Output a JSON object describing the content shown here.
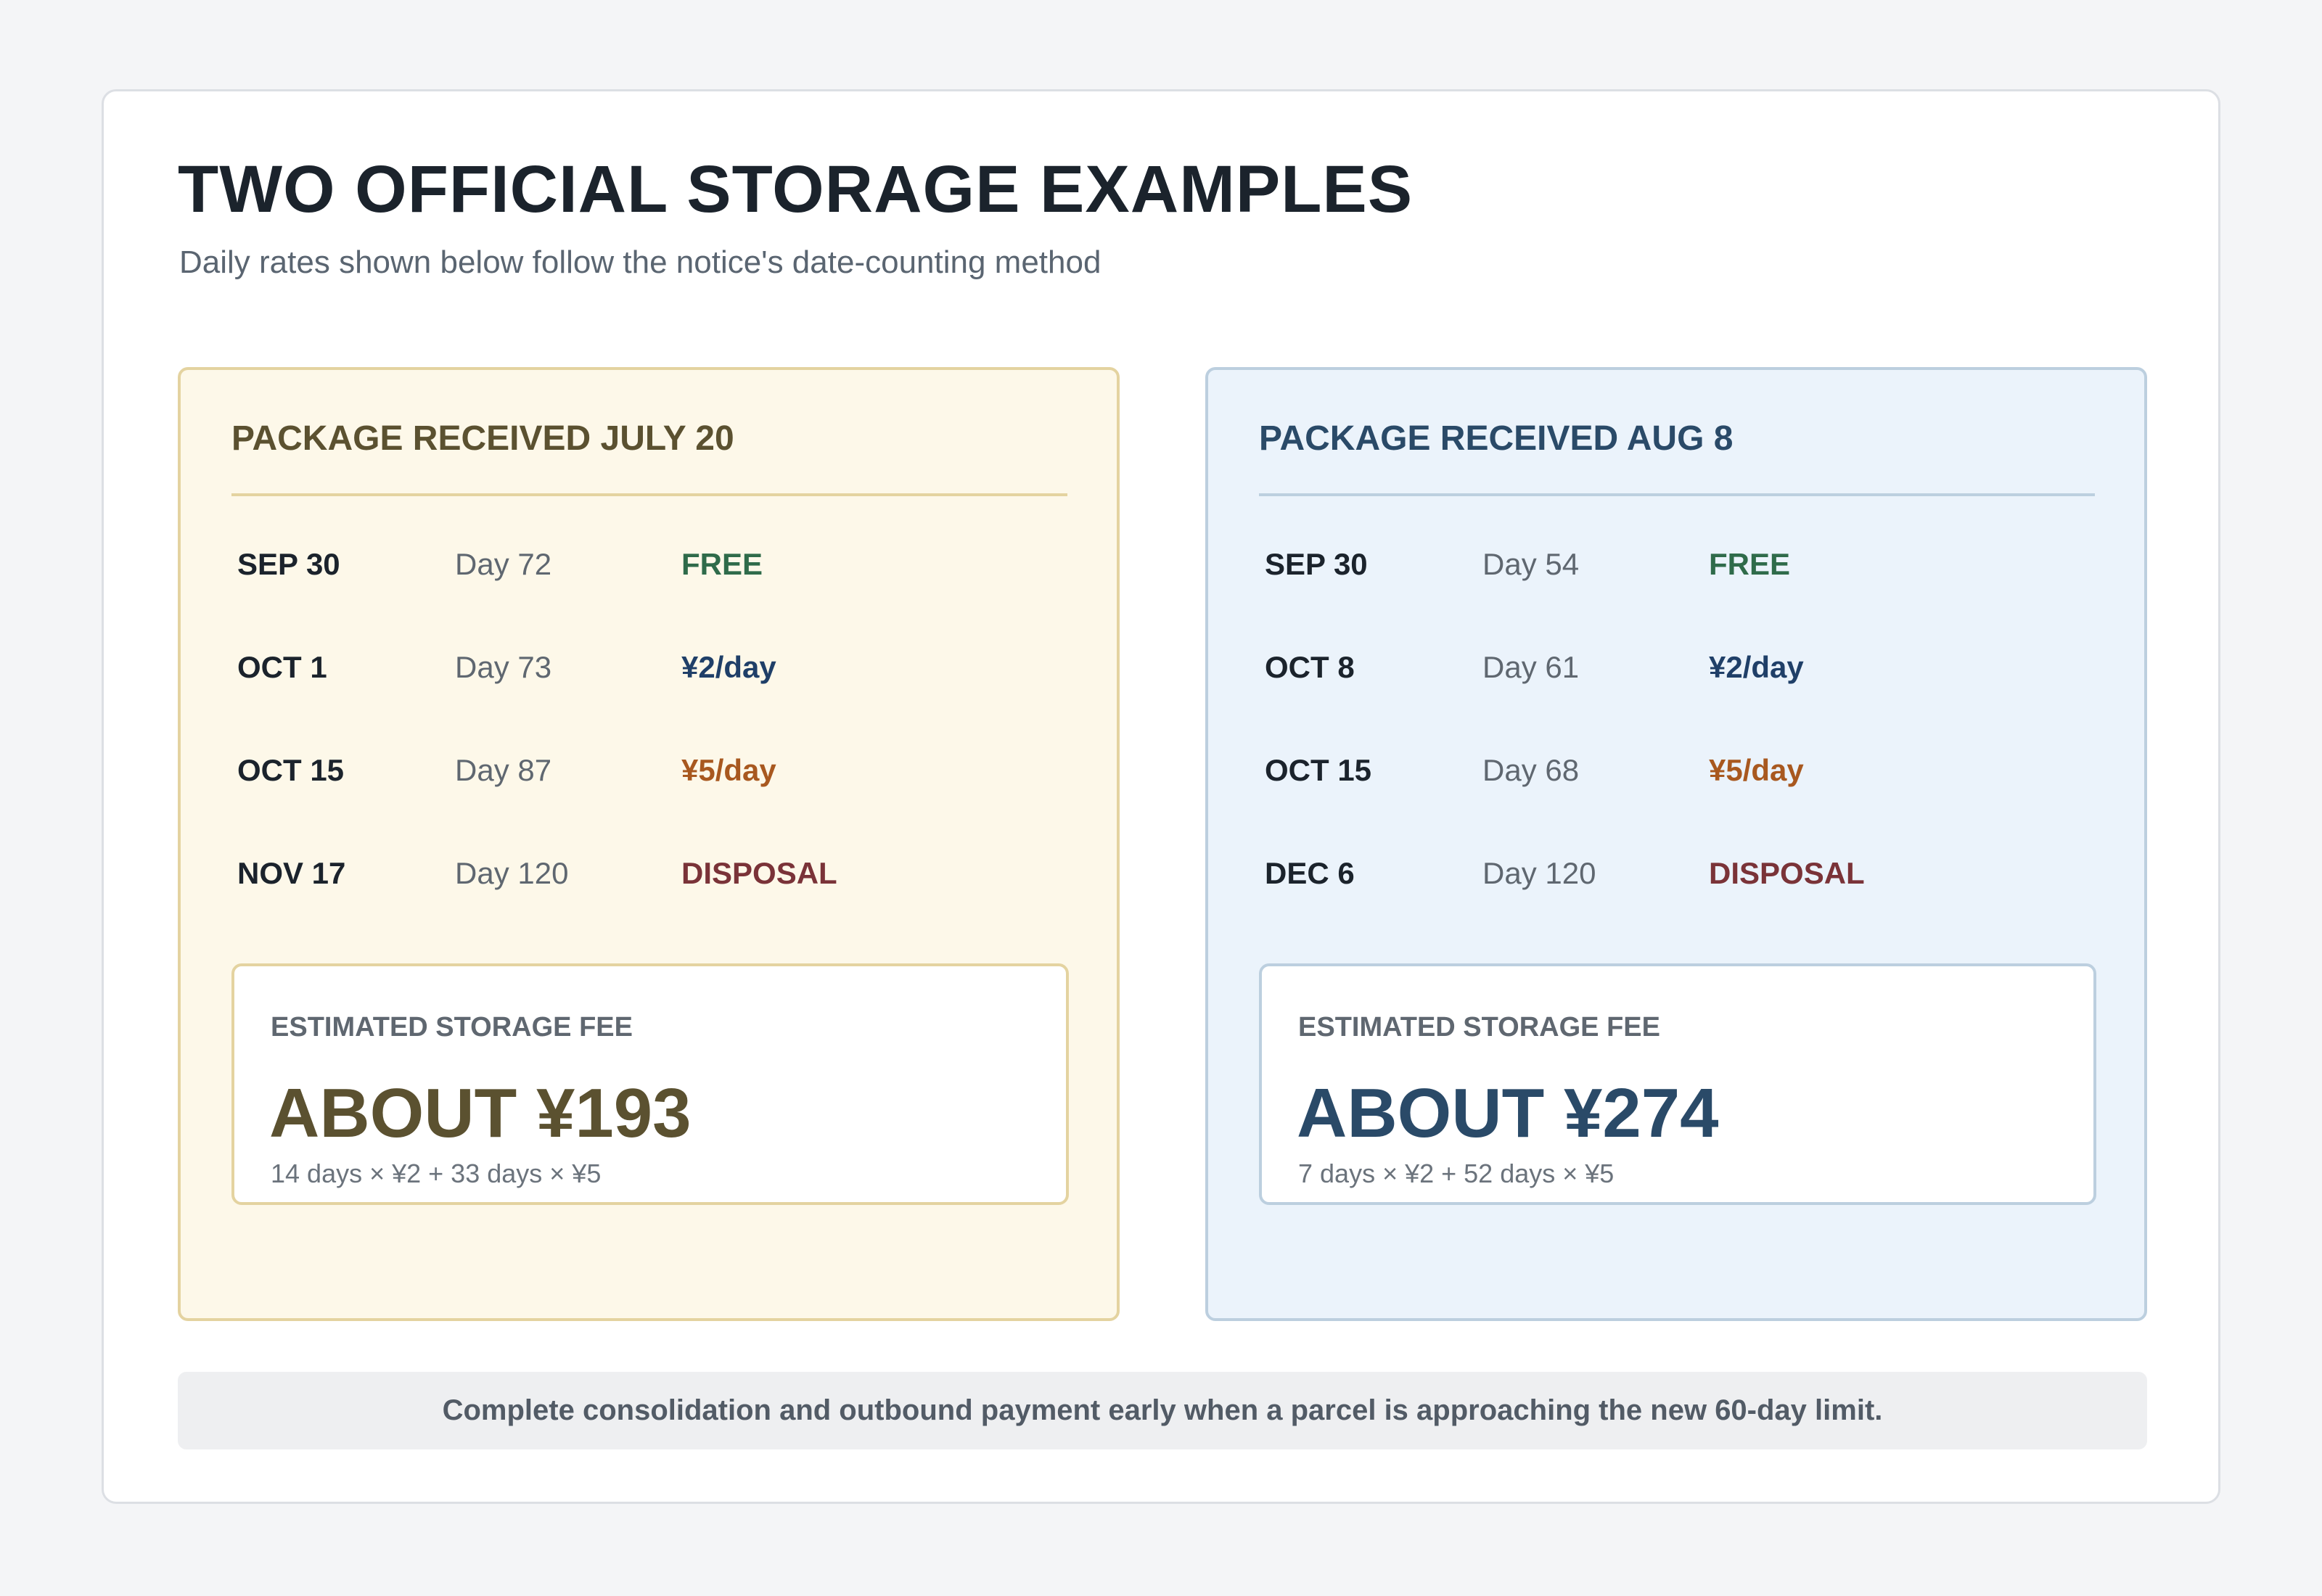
{
  "header": {
    "title": "TWO OFFICIAL STORAGE EXAMPLES",
    "subtitle": "Daily rates shown below follow the notice's date-counting method"
  },
  "examples": [
    {
      "heading": "PACKAGE RECEIVED JULY 20",
      "rows": [
        {
          "date": "SEP 30",
          "day": "Day 72",
          "status": "FREE"
        },
        {
          "date": "OCT 1",
          "day": "Day 73",
          "status": "¥2/day"
        },
        {
          "date": "OCT 15",
          "day": "Day 87",
          "status": "¥5/day"
        },
        {
          "date": "NOV 17",
          "day": "Day 120",
          "status": "DISPOSAL"
        }
      ],
      "fee": {
        "label": "ESTIMATED STORAGE FEE",
        "amount": "ABOUT ¥193",
        "formula": "14 days × ¥2 + 33 days × ¥5"
      }
    },
    {
      "heading": "PACKAGE RECEIVED AUG 8",
      "rows": [
        {
          "date": "SEP 30",
          "day": "Day 54",
          "status": "FREE"
        },
        {
          "date": "OCT 8",
          "day": "Day 61",
          "status": "¥2/day"
        },
        {
          "date": "OCT 15",
          "day": "Day 68",
          "status": "¥5/day"
        },
        {
          "date": "DEC 6",
          "day": "Day 120",
          "status": "DISPOSAL"
        }
      ],
      "fee": {
        "label": "ESTIMATED STORAGE FEE",
        "amount": "ABOUT ¥274",
        "formula": "7 days × ¥2 + 52 days × ¥5"
      }
    }
  ],
  "footer": {
    "note": "Complete consolidation and outbound payment early when a parcel is approaching the new 60-day limit."
  },
  "colors": {
    "free": "#2f6b4a",
    "rate_2": "#1f3f68",
    "rate_5": "#a8581f",
    "disposal": "#7a3338",
    "gold_panel": "#fdf8e9",
    "blue_panel": "#ebf3fb"
  }
}
